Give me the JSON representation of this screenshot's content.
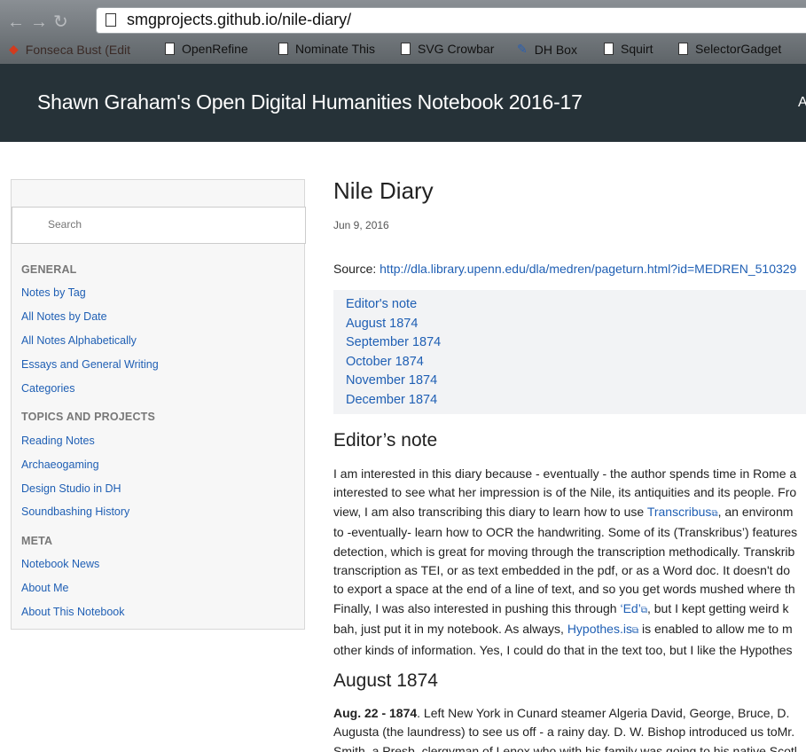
{
  "browser": {
    "url": "smgprojects.github.io/nile-diary/",
    "bookmarks": [
      "Fonseca Bust (Edit",
      "OpenRefine",
      "Nominate This",
      "SVG Crowbar",
      "DH Box",
      "Squirt",
      "SelectorGadget"
    ]
  },
  "site": {
    "title": "Shawn Graham's Open Digital Humanities Notebook 2016-17",
    "header_link": "A"
  },
  "sidebar": {
    "search_placeholder": "Search",
    "sections": [
      {
        "heading": "GENERAL",
        "items": [
          "Notes by Tag",
          "All Notes by Date",
          "All Notes Alphabetically",
          "Essays and General Writing",
          "Categories"
        ]
      },
      {
        "heading": "TOPICS AND PROJECTS",
        "items": [
          "Reading Notes",
          "Archaeogaming",
          "Design Studio in DH",
          "Soundbashing History"
        ]
      },
      {
        "heading": "META",
        "items": [
          "Notebook News",
          "About Me",
          "About This Notebook"
        ]
      }
    ]
  },
  "post": {
    "title": "Nile Diary",
    "date": "Jun 9, 2016",
    "source_label": "Source: ",
    "source_url": "http://dla.library.upenn.edu/dla/medren/pageturn.html?id=MEDREN_510329",
    "toc": [
      "Editor's note",
      "August 1874",
      "September 1874",
      "October 1874",
      "November 1874",
      "December 1874"
    ],
    "section1_title": "Editor’s note",
    "p1": {
      "l1": "I am interested in this diary because - eventually - the author spends time in Rome a",
      "l2": "interested to see what her impression is of the Nile, its antiquities and its people. Fro",
      "l3a": "view, I am also transcribing this diary to learn how to use ",
      "l3link": "Transcribus",
      "l3b": ", an environm",
      "l4": "to -eventually- learn how to OCR the handwriting. Some of its (Transkribus’) features",
      "l5": "detection, which is great for moving through the transcription methodically. Transkrib",
      "l6": "transcription as TEI, or as text embedded in the pdf, or as a Word doc. It doesn't do",
      "l7": "to export a space at the end of a line of text, and so you get words mushed where th",
      "l8a": "Finally, I was also interested in pushing this through ",
      "l8link": "‘Ed’",
      "l8b": ", but I kept getting weird k",
      "l9a": "bah, just put it in my notebook. As always, ",
      "l9link": "Hypothes.is",
      "l9b": " is enabled to allow me to m",
      "l10": "other kinds of information. Yes, I could do that in the text too, but I like the Hypothes"
    },
    "section2_title": "August 1874",
    "p2": {
      "date_bold": "Aug. 22 - 1874",
      "l1rest": ". Left New York in Cunard steamer Algeria David, George, Bruce, D.",
      "l2": "Augusta (the laundress) to see us off - a rainy day. D. W. Bishop introduced us toMr.",
      "l3": "Smith, a Presb. clergyman of Lenox who with his family was going to his native Scotl"
    }
  }
}
